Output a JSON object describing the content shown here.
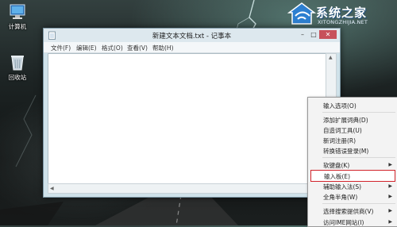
{
  "desktop": {
    "icons": [
      {
        "label": "计算机",
        "icon": "computer-icon"
      },
      {
        "label": "回收站",
        "icon": "recycle-bin-icon"
      }
    ]
  },
  "watermark": {
    "title": "系统之家",
    "url": "XITONGZHIJIA.NET"
  },
  "notepad": {
    "title": "新建文本文档.txt - 记事本",
    "menu": [
      "文件(F)",
      "编辑(E)",
      "格式(O)",
      "查看(V)",
      "帮助(H)"
    ],
    "content": ""
  },
  "context_menu": {
    "items": [
      {
        "label": "输入选项(O)",
        "submenu": false
      },
      {
        "label": "添加扩展词典(D)",
        "submenu": false
      },
      {
        "label": "自造词工具(U)",
        "submenu": false
      },
      {
        "label": "新词注册(R)",
        "submenu": false
      },
      {
        "label": "转换错误登录(M)",
        "submenu": false
      },
      {
        "label": "软键盘(K)",
        "submenu": true
      },
      {
        "label": "输入板(E)",
        "submenu": false,
        "highlighted": true
      },
      {
        "label": "辅助输入法(S)",
        "submenu": true
      },
      {
        "label": "全角半角(W)",
        "submenu": true
      },
      {
        "label": "选择搜索提供商(V)",
        "submenu": true
      },
      {
        "label": "访问IME网站(I)",
        "submenu": true
      }
    ]
  },
  "colors": {
    "highlight_border": "#d2232a",
    "close_button": "#c7515b",
    "title_bar": "#dde8ee"
  }
}
